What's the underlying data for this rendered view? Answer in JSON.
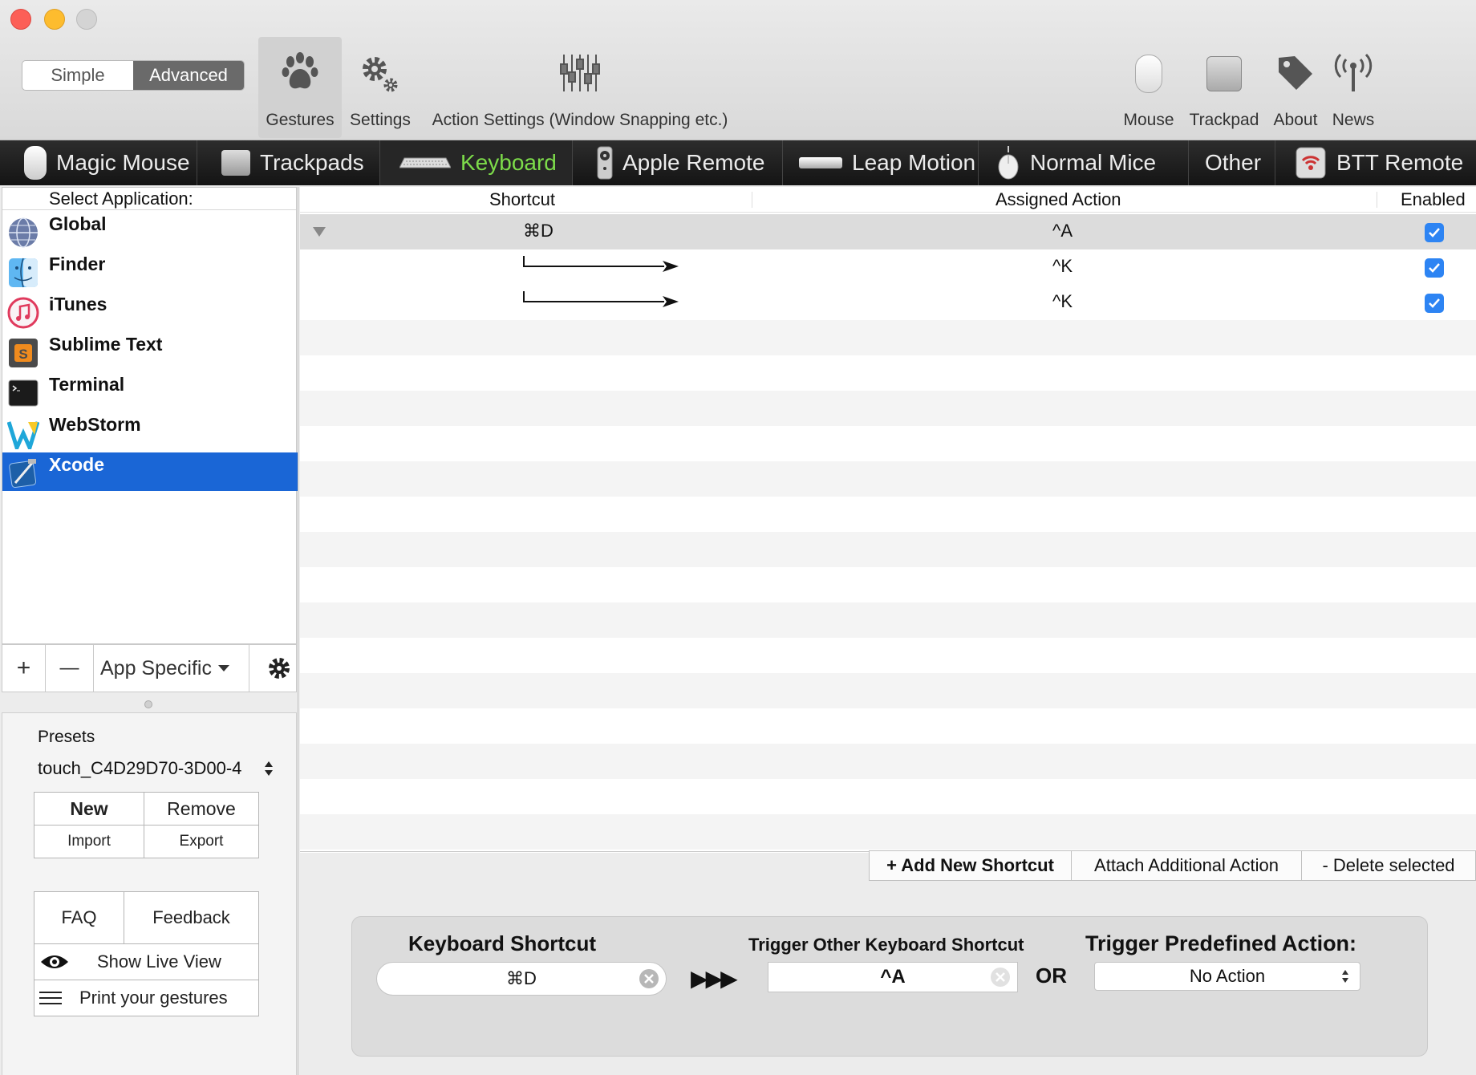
{
  "toolbar": {
    "mode_simple": "Simple",
    "mode_advanced": "Advanced",
    "gestures": "Gestures",
    "settings": "Settings",
    "action_settings": "Action Settings (Window Snapping etc.)",
    "mouse": "Mouse",
    "trackpad": "Trackpad",
    "about": "About",
    "news": "News"
  },
  "device_tabs": {
    "magic_mouse": "Magic Mouse",
    "trackpads": "Trackpads",
    "keyboard": "Keyboard",
    "apple_remote": "Apple Remote",
    "leap_motion": "Leap Motion",
    "normal_mice": "Normal Mice",
    "other": "Other",
    "btt_remote": "BTT Remote",
    "active_color": "#7ddc4a"
  },
  "sidebar": {
    "header": "Select Application:",
    "apps": [
      {
        "name": "Global",
        "icon": "globe-icon"
      },
      {
        "name": "Finder",
        "icon": "finder-icon"
      },
      {
        "name": "iTunes",
        "icon": "itunes-icon"
      },
      {
        "name": "Sublime Text",
        "icon": "sublime-icon"
      },
      {
        "name": "Terminal",
        "icon": "terminal-icon"
      },
      {
        "name": "WebStorm",
        "icon": "webstorm-icon"
      },
      {
        "name": "Xcode",
        "icon": "xcode-icon",
        "selected": true
      }
    ],
    "add": "+",
    "remove": "—",
    "app_specific": "App Specific",
    "presets_label": "Presets",
    "preset_value": "touch_C4D29D70-3D00-4",
    "new": "New",
    "remove_preset": "Remove",
    "import": "Import",
    "export": "Export",
    "faq": "FAQ",
    "feedback": "Feedback",
    "show_live_view": "Show Live View",
    "print_gestures": "Print your gestures",
    "selection_color": "#1a66d6"
  },
  "table": {
    "headers": {
      "shortcut": "Shortcut",
      "action": "Assigned Action",
      "enabled": "Enabled"
    },
    "rows": [
      {
        "shortcut": "⌘D",
        "action": "^A",
        "enabled": true
      },
      {
        "shortcut": "",
        "action": "^K",
        "enabled": true
      },
      {
        "shortcut": "",
        "action": "^K",
        "enabled": true
      }
    ]
  },
  "actions": {
    "add_new": "+ Add New Shortcut",
    "attach": "Attach Additional Action",
    "delete": "- Delete selected"
  },
  "panel": {
    "keyboard_shortcut_label": "Keyboard Shortcut",
    "keyboard_shortcut_value": "⌘D",
    "arrows": "▶▶▶",
    "trigger_other_label": "Trigger Other Keyboard Shortcut",
    "trigger_other_value": "^A",
    "or": "OR",
    "predefined_label": "Trigger Predefined Action:",
    "predefined_value": "No Action"
  }
}
